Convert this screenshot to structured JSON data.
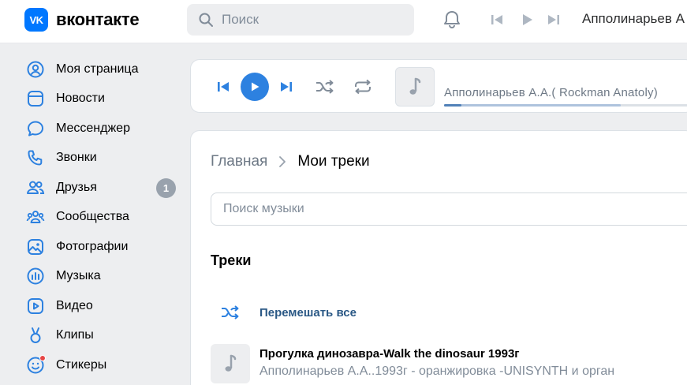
{
  "header": {
    "logo_badge": "VK",
    "logo_text": "вконтакте",
    "search_placeholder": "Поиск",
    "now_playing_artist": "Апполинарьев А"
  },
  "sidebar": {
    "items": [
      {
        "label": "Моя страница",
        "icon": "user-circle-icon"
      },
      {
        "label": "Новости",
        "icon": "newsfeed-icon"
      },
      {
        "label": "Мессенджер",
        "icon": "message-icon"
      },
      {
        "label": "Звонки",
        "icon": "phone-icon"
      },
      {
        "label": "Друзья",
        "icon": "users-icon",
        "badge": "1"
      },
      {
        "label": "Сообщества",
        "icon": "groups-icon"
      },
      {
        "label": "Фотографии",
        "icon": "photo-icon"
      },
      {
        "label": "Музыка",
        "icon": "music-icon"
      },
      {
        "label": "Видео",
        "icon": "video-icon"
      },
      {
        "label": "Клипы",
        "icon": "clips-icon"
      },
      {
        "label": "Стикеры",
        "icon": "sticker-icon"
      }
    ]
  },
  "player": {
    "track_title": "Апполинарьев А.А.( Rockman Anatoly)",
    "progress": 0.07,
    "buffered": 0.7
  },
  "content": {
    "breadcrumb_home": "Главная",
    "breadcrumb_current": "Мои треки",
    "search_placeholder": "Поиск музыки",
    "section_title": "Треки",
    "shuffle_label": "Перемешать все",
    "tracks": [
      {
        "title": "Прогулка динозавра-Walk the dinosaur 1993г",
        "subtitle": "Апполинарьев А.А..1993г - оранжировка -UNISYNTH и орган"
      }
    ]
  },
  "colors": {
    "accent": "#2d81e0",
    "brand": "#0077ff",
    "link": "#2a5885",
    "icon": "#2d81e0"
  }
}
